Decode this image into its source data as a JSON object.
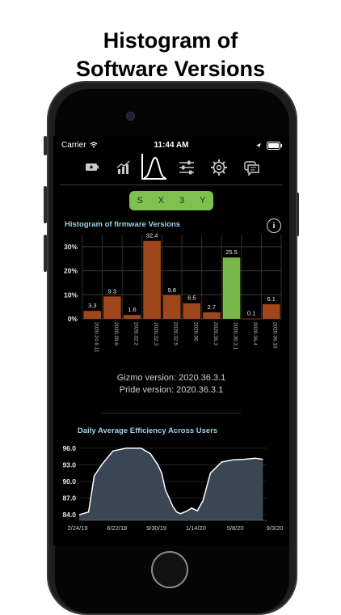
{
  "headline": {
    "line1": "Histogram of",
    "line2": "Software Versions"
  },
  "status_bar": {
    "carrier": "Carrier",
    "time": "11:44 AM"
  },
  "toolbar": {
    "icons": [
      "battery-icon",
      "bar-chart-icon",
      "distribution-icon",
      "sliders-icon",
      "gear-icon",
      "message-icon"
    ],
    "active": "distribution-icon"
  },
  "segment": {
    "letters": [
      "S",
      "X",
      "3",
      "Y"
    ],
    "color": "#7dc24e"
  },
  "versions": {
    "gizmo": "Gizmo version: 2020.36.3.1",
    "pride": "Pride version: 2020.36.3.1"
  },
  "colors": {
    "bar": "#a0461c",
    "bar_highlight": "#79b84a",
    "title": "#9fd0e6",
    "line": "#ffffff",
    "area": "#3b4654"
  },
  "chart_data": [
    {
      "type": "bar",
      "title": "Histogram of firmware Versions",
      "categories": [
        "2020.24.6.11",
        "2020.28.6",
        "2020.32.2",
        "2020.32.3",
        "2020.32.5",
        "2020.36",
        "2020.36.3",
        "2020.36.3.1",
        "2020.36.4",
        "2020.36.10"
      ],
      "values": [
        3.3,
        9.3,
        1.6,
        32.4,
        9.8,
        6.5,
        2.7,
        25.5,
        0.1,
        6.1
      ],
      "value_labels": [
        "3.3",
        "9.3",
        "1.6",
        "32.4",
        "9.8",
        "6.5",
        "2.7",
        "25.5",
        "0.1",
        "6.1"
      ],
      "highlight": "2020.36.3.1",
      "ylim": [
        0,
        35
      ],
      "yticks": [
        "0%",
        "10%",
        "20%",
        "30%"
      ],
      "ytick_values": [
        0,
        10,
        20,
        30
      ],
      "grid": true
    },
    {
      "type": "area",
      "title": "Daily Average Efficiency Across Users",
      "ylim": [
        83,
        97
      ],
      "yticks": [
        "84.0",
        "87.0",
        "90.0",
        "93.0",
        "96.0"
      ],
      "ytick_values": [
        84,
        87,
        90,
        93,
        96
      ],
      "xticks": [
        "2/24/19",
        "6/22/19",
        "9/30/19",
        "1/14/20",
        "5/8/20",
        "9/3/20"
      ],
      "x": [
        0,
        0.05,
        0.08,
        0.12,
        0.18,
        0.25,
        0.33,
        0.38,
        0.42,
        0.44,
        0.46,
        0.5,
        0.52,
        0.54,
        0.57,
        0.6,
        0.63,
        0.66,
        0.7,
        0.76,
        0.82,
        0.88,
        0.94,
        0.98
      ],
      "y": [
        84.0,
        84.5,
        91.0,
        93.0,
        95.5,
        96.0,
        96.0,
        95.0,
        93.0,
        91.5,
        88.5,
        85.5,
        84.5,
        84.2,
        84.6,
        85.2,
        84.7,
        86.5,
        91.5,
        93.5,
        93.9,
        94.0,
        94.2,
        94.0
      ]
    }
  ]
}
